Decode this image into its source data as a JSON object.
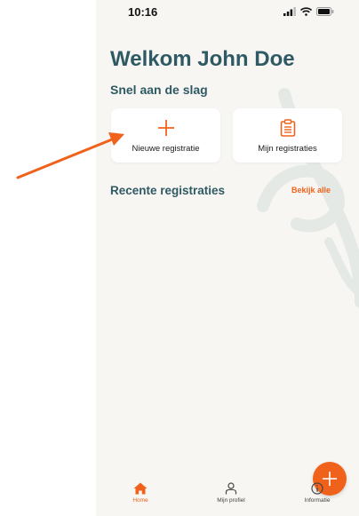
{
  "status_bar": {
    "time": "10:16"
  },
  "header": {
    "welcome": "Welkom John Doe"
  },
  "quick_start": {
    "title": "Snel aan de slag",
    "new_registration_label": "Nieuwe registratie",
    "my_registrations_label": "Mijn registraties"
  },
  "recent": {
    "title": "Recente registraties",
    "see_all_label": "Bekijk alle"
  },
  "bottom_nav": {
    "items": [
      {
        "label": "Home",
        "icon": "home-icon",
        "active": true
      },
      {
        "label": "Mijn profiel",
        "icon": "profile-icon",
        "active": false
      },
      {
        "label": "Informatie",
        "icon": "info-icon",
        "active": false
      }
    ]
  },
  "colors": {
    "accent": "#f0621b",
    "heading": "#2f5a64",
    "background": "#f7f6f3",
    "annotation_arrow": "#f0621b"
  }
}
